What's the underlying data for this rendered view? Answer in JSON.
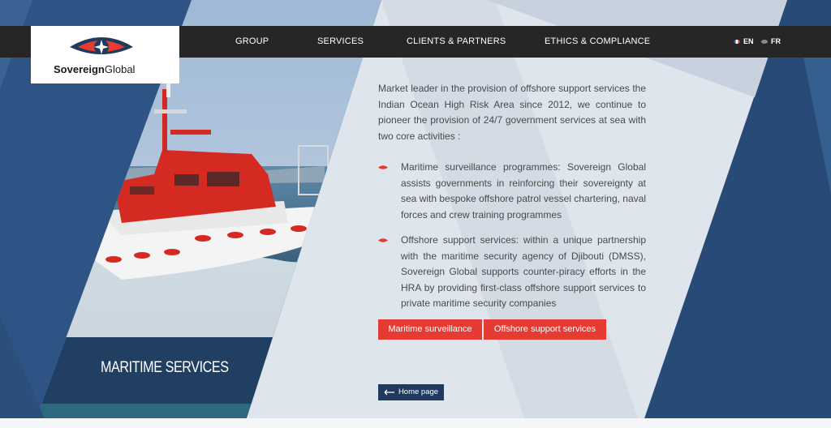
{
  "brand": {
    "name_bold": "Sovereign",
    "name_light": "Global"
  },
  "nav": {
    "items": [
      "GROUP",
      "SERVICES",
      "CLIENTS & PARTNERS",
      "ETHICS & COMPLIANCE"
    ]
  },
  "languages": {
    "en": "EN",
    "fr": "FR"
  },
  "hero": {
    "section_title": "MARITIME SERVICES"
  },
  "content": {
    "intro": "Market leader in the provision of offshore support services the Indian Ocean High Risk Area since 2012, we continue to pioneer the provision of 24/7 government services at sea with two core activities :",
    "bullets": [
      "Maritime surveillance programmes: Sovereign Global assists governments in reinforcing their sovereignty at sea with bespoke offshore patrol vessel chartering, naval forces and crew training programmes",
      "Offshore support services: within a unique partnership with the maritime security agency of Djibouti (DMSS), Sovereign Global supports counter-piracy efforts in the HRA by providing first-class offshore support services to private maritime security companies"
    ]
  },
  "buttons": {
    "maritime": "Maritime surveillance",
    "offshore": "Offshore support services",
    "home": "Home page"
  },
  "colors": {
    "navbar": "#262626",
    "accent": "#e53b32",
    "panel": "#dfe5ec",
    "navy": "#2e5485"
  }
}
